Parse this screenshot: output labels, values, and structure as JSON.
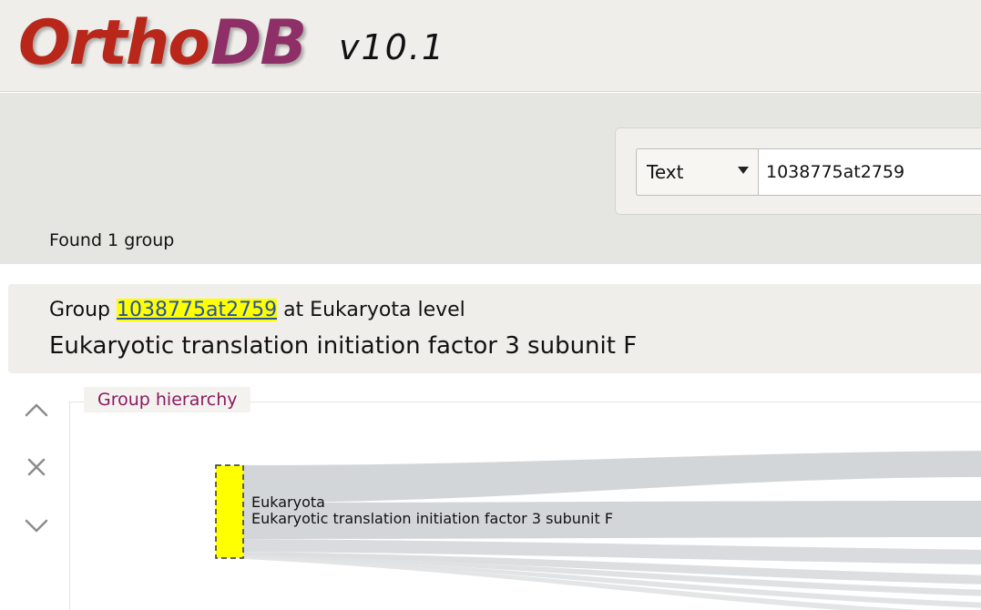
{
  "header": {
    "logo_part1": "Ortho",
    "logo_part2": "DB",
    "version": "v10.1"
  },
  "search": {
    "type_selected": "Text",
    "query_value": "1038775at2759",
    "results_count_text": "Found 1 group"
  },
  "group": {
    "prefix": "Group",
    "id": "1038775at2759",
    "level_text": "at Eukaryota level",
    "description": "Eukaryotic translation initiation factor 3 subunit F"
  },
  "side_controls": {
    "up_icon": "chevron-up-icon",
    "close_icon": "close-icon",
    "down_icon": "chevron-down-icon"
  },
  "hierarchy": {
    "title": "Group hierarchy",
    "node_level": "Eukaryota",
    "node_description": "Eukaryotic translation initiation factor 3 subunit F",
    "node_color": "#ffff00",
    "link_color": "#d3d6d9"
  }
}
